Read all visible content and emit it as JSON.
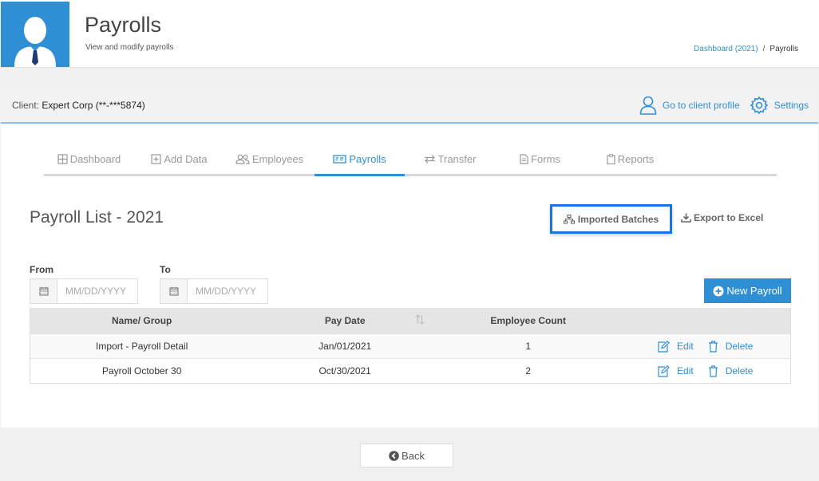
{
  "header": {
    "title": "Payrolls",
    "subtitle": "View and modify payrolls",
    "breadcrumb": {
      "link": "Dashboard (2021)",
      "separator": "/",
      "current": "Payrolls"
    }
  },
  "client": {
    "label": "Client:",
    "name": "Expert Corp (**-***5874)",
    "profile_link": "Go to client profile",
    "settings_link": "Settings"
  },
  "tabs": [
    {
      "label": "Dashboard",
      "icon": "grid-icon"
    },
    {
      "label": "Add Data",
      "icon": "plus-square-icon"
    },
    {
      "label": "Employees",
      "icon": "users-icon"
    },
    {
      "label": "Payrolls",
      "icon": "payroll-icon",
      "active": true
    },
    {
      "label": "Transfer",
      "icon": "transfer-icon"
    },
    {
      "label": "Forms",
      "icon": "document-icon"
    },
    {
      "label": "Reports",
      "icon": "clipboard-icon"
    }
  ],
  "list": {
    "title": "Payroll List - 2021",
    "imported_batches": "Imported Batches",
    "export": "Export to Excel",
    "from_label": "From",
    "to_label": "To",
    "date_placeholder": "MM/DD/YYYY",
    "new_payroll": "New Payroll"
  },
  "table": {
    "headers": [
      "Name/ Group",
      "Pay Date",
      "Employee Count"
    ],
    "rows": [
      {
        "name": "Import - Payroll Detail",
        "pay_date": "Jan/01/2021",
        "count": "1",
        "edit": "Edit",
        "delete": "Delete"
      },
      {
        "name": "Payroll October 30",
        "pay_date": "Oct/30/2021",
        "count": "2",
        "edit": "Edit",
        "delete": "Delete"
      }
    ]
  },
  "footer": {
    "back": "Back"
  },
  "colors": {
    "accent": "#2f8fd4",
    "highlight_border": "#1a73e8",
    "table_header": "#e5e5e5"
  }
}
